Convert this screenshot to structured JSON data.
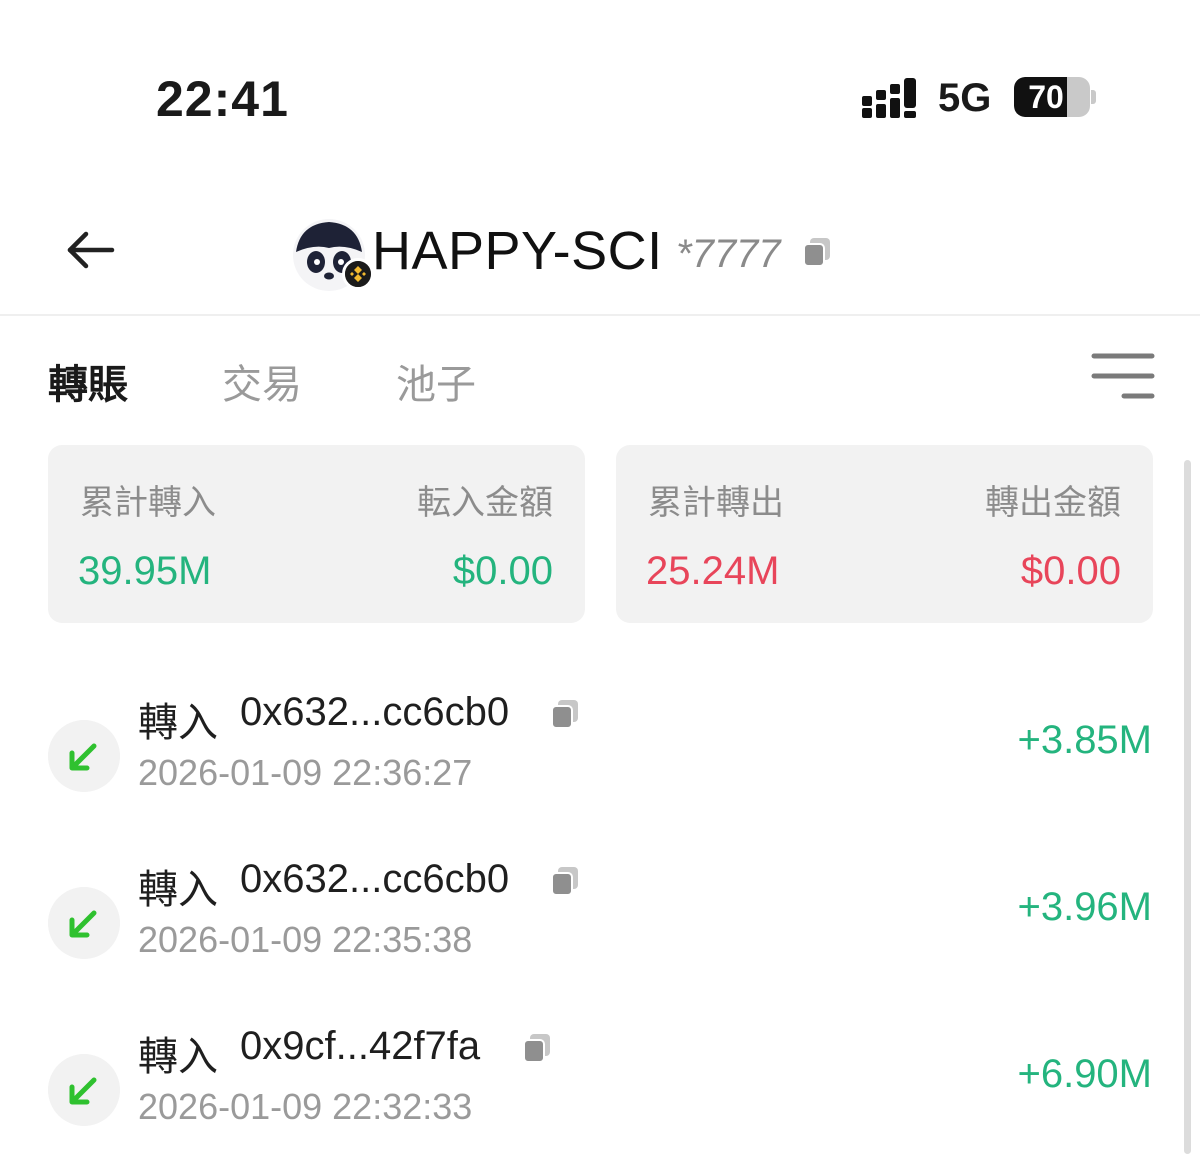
{
  "status_bar": {
    "time": "22:41",
    "network": "5G",
    "battery": "70",
    "battery_level": 0.7
  },
  "header": {
    "name": "HAPPY-SCI",
    "suffix": "*7777",
    "avatar_icon": "panda-avatar-icon",
    "badge_icon": "bnb-chain-icon"
  },
  "tabs": [
    {
      "label": "轉賬",
      "active": true
    },
    {
      "label": "交易",
      "active": false
    },
    {
      "label": "池子",
      "active": false
    }
  ],
  "summary": {
    "in": {
      "label": "累計轉入",
      "value": "39.95M",
      "amount_label": "転入金額",
      "amount": "$0.00"
    },
    "out": {
      "label": "累計轉出",
      "value": "25.24M",
      "amount_label": "轉出金額",
      "amount": "$0.00"
    }
  },
  "transactions": [
    {
      "type": "轉入",
      "address": "0x632...cc6cb0",
      "time": "2026-01-09 22:36:27",
      "amount": "+3.85M"
    },
    {
      "type": "轉入",
      "address": "0x632...cc6cb0",
      "time": "2026-01-09 22:35:38",
      "amount": "+3.96M"
    },
    {
      "type": "轉入",
      "address": "0x9cf...42f7fa",
      "time": "2026-01-09 22:32:33",
      "amount": "+6.90M"
    }
  ],
  "colors": {
    "positive": "#24b47e",
    "negative": "#e8455a",
    "arrow": "#2fc12f",
    "card_bg": "#f2f2f2"
  }
}
